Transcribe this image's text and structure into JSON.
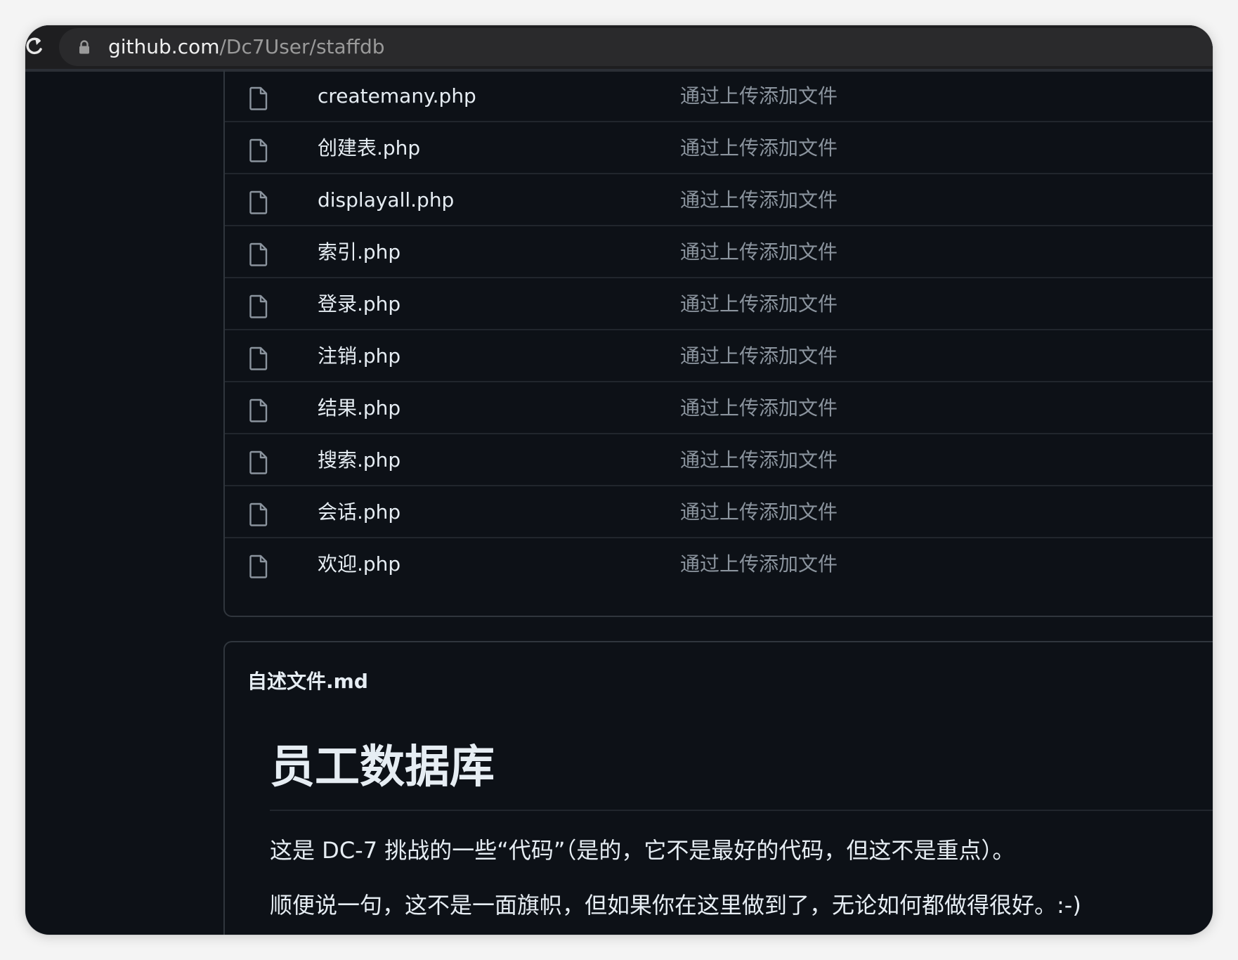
{
  "browser": {
    "reload_icon": "reload-icon",
    "lock_icon": "lock-icon",
    "url_host": "github.com",
    "url_path": "/Dc7User/staffdb"
  },
  "files": [
    {
      "name": "createmany.php",
      "message": "通过上传添加文件",
      "icon": "file-icon"
    },
    {
      "name": "创建表.php",
      "message": "通过上传添加文件",
      "icon": "file-icon"
    },
    {
      "name": "displayall.php",
      "message": "通过上传添加文件",
      "icon": "file-icon"
    },
    {
      "name": "索引.php",
      "message": "通过上传添加文件",
      "icon": "file-icon"
    },
    {
      "name": "登录.php",
      "message": "通过上传添加文件",
      "icon": "file-icon"
    },
    {
      "name": "注销.php",
      "message": "通过上传添加文件",
      "icon": "file-icon"
    },
    {
      "name": "结果.php",
      "message": "通过上传添加文件",
      "icon": "file-icon"
    },
    {
      "name": "搜索.php",
      "message": "通过上传添加文件",
      "icon": "file-icon"
    },
    {
      "name": "会话.php",
      "message": "通过上传添加文件",
      "icon": "file-icon"
    },
    {
      "name": "欢迎.php",
      "message": "通过上传添加文件",
      "icon": "file-icon"
    }
  ],
  "readme": {
    "filename": "自述文件.md",
    "title": "员工数据库",
    "paragraphs": [
      "这是 DC-7 挑战的一些“代码”（是的，它不是最好的代码，但这不是重点）。",
      "顺便说一句，这不是一面旗帜，但如果你在这里做到了，无论如何都做得很好。:-)"
    ]
  },
  "colors": {
    "background": "#0d1117",
    "text": "#e6edf3",
    "muted": "#8b949e",
    "border": "#30363d"
  }
}
